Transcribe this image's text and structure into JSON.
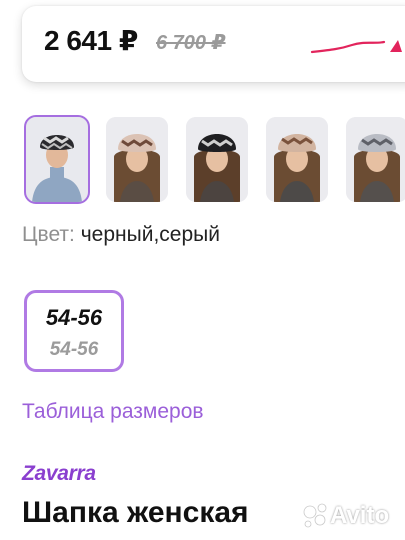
{
  "price": {
    "current": "2 641 ₽",
    "old": "6 700 ₽",
    "accent_color": "#e2245c"
  },
  "gallery": {
    "thumbnails": [
      {
        "name": "photo-1",
        "selected": true
      },
      {
        "name": "photo-2",
        "selected": false
      },
      {
        "name": "photo-3",
        "selected": false
      },
      {
        "name": "photo-4",
        "selected": false
      },
      {
        "name": "photo-5",
        "selected": false
      }
    ]
  },
  "color": {
    "label": "Цвет:",
    "value": "черный,серый"
  },
  "size": {
    "main": "54-56",
    "sub": "54-56"
  },
  "size_table_link": "Таблица размеров",
  "brand": "Zavarra",
  "product_title": "Шапка женская",
  "watermark": {
    "text": "Avito",
    "icon": "avito-logo-icon"
  },
  "colors": {
    "selection": "#a56ee0",
    "link": "#9b5fd9",
    "brand": "#8a3fcf"
  }
}
